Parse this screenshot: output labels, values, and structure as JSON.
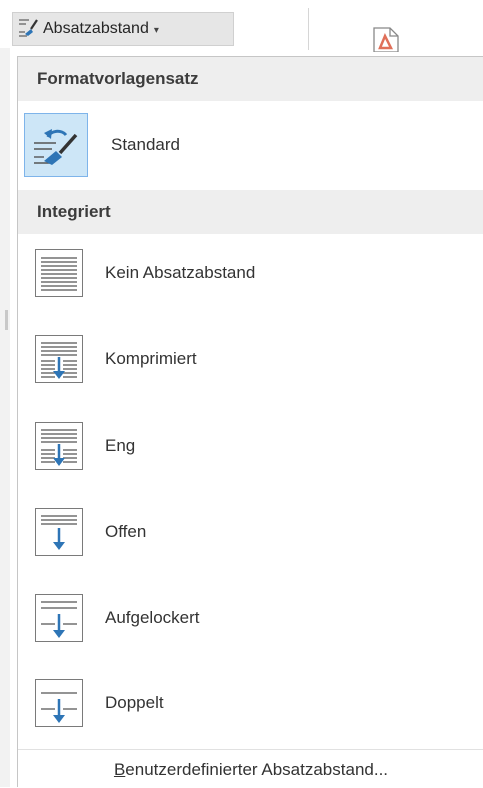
{
  "ribbon": {
    "button_label": "Absatzabstand",
    "caret": "▾"
  },
  "menu": {
    "sections": [
      {
        "title": "Formatvorlagensatz",
        "items": [
          {
            "label": "Standard",
            "icon": "paragraph-spacing-brush-icon",
            "selected": true
          }
        ]
      },
      {
        "title": "Integriert",
        "items": [
          {
            "label": "Kein Absatzabstand",
            "icon": "no-spacing-icon"
          },
          {
            "label": "Komprimiert",
            "icon": "compact-spacing-icon"
          },
          {
            "label": "Eng",
            "icon": "tight-spacing-icon"
          },
          {
            "label": "Offen",
            "icon": "open-spacing-icon"
          },
          {
            "label": "Aufgelockert",
            "icon": "relaxed-spacing-icon"
          },
          {
            "label": "Doppelt",
            "icon": "double-spacing-icon"
          }
        ]
      }
    ],
    "footer": {
      "mnemonic": "B",
      "rest": "enutzerdefinierter Absatzabstand..."
    }
  },
  "colors": {
    "accent": "#2e75b6",
    "selected_bg": "#cde6f7",
    "selected_border": "#7eb4ea",
    "header_bg": "#eeeeee"
  }
}
